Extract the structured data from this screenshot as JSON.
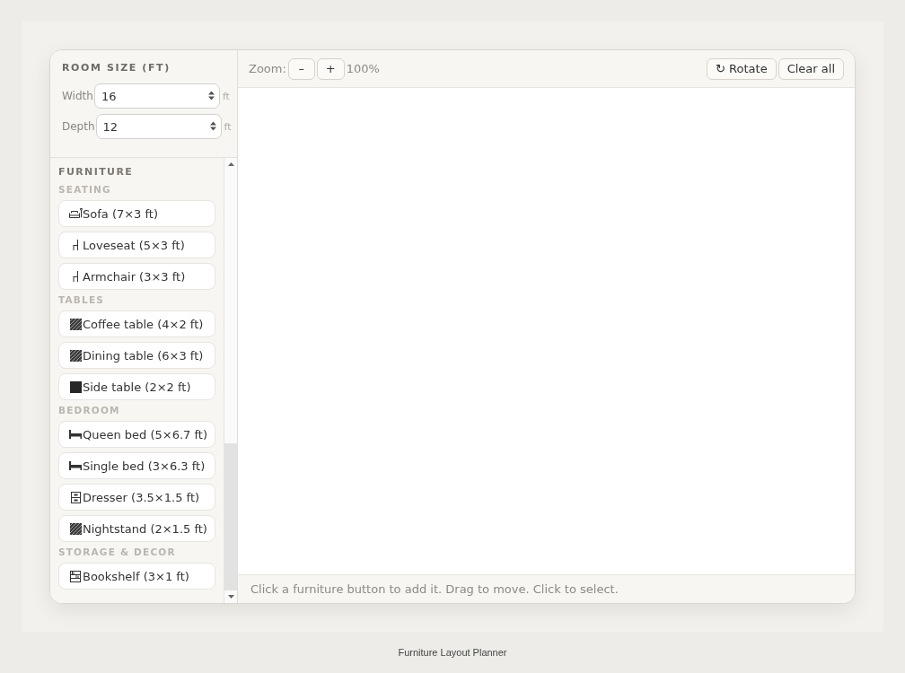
{
  "room_size": {
    "title": "ROOM SIZE (FT)",
    "fields": [
      {
        "label": "Width",
        "value": "16",
        "unit": "ft"
      },
      {
        "label": "Depth",
        "value": "12",
        "unit": "ft"
      }
    ]
  },
  "furniture": {
    "title": "FURNITURE",
    "groups": [
      {
        "name": "SEATING",
        "items": [
          {
            "label": "Sofa (7×3 ft)",
            "kind": "sofa"
          },
          {
            "label": "Loveseat (5×3 ft)",
            "kind": "chair"
          },
          {
            "label": "Armchair (3×3 ft)",
            "kind": "chair"
          }
        ]
      },
      {
        "name": "TABLES",
        "items": [
          {
            "label": "Coffee table (4×2 ft)",
            "kind": "hatched"
          },
          {
            "label": "Dining table (6×3 ft)",
            "kind": "hatched"
          },
          {
            "label": "Side table (2×2 ft)",
            "kind": "solid"
          }
        ]
      },
      {
        "name": "BEDROOM",
        "items": [
          {
            "label": "Queen bed (5×6.7 ft)",
            "kind": "bed"
          },
          {
            "label": "Single bed (3×6.3 ft)",
            "kind": "bed"
          },
          {
            "label": "Dresser (3.5×1.5 ft)",
            "kind": "cabinet"
          },
          {
            "label": "Nightstand (2×1.5 ft)",
            "kind": "hatched"
          }
        ]
      },
      {
        "name": "STORAGE & DECOR",
        "items": [
          {
            "label": "Bookshelf (3×1 ft)",
            "kind": "shelf"
          }
        ]
      }
    ]
  },
  "toolbar": {
    "zoom_label": "Zoom:",
    "zoom_out": "–",
    "zoom_in": "+",
    "zoom_level": "100%",
    "rotate": "↻ Rotate",
    "clear_all": "Clear all"
  },
  "status_bar": "Click a furniture button to add it. Drag to move. Click to select.",
  "caption": "Furniture Layout Planner"
}
